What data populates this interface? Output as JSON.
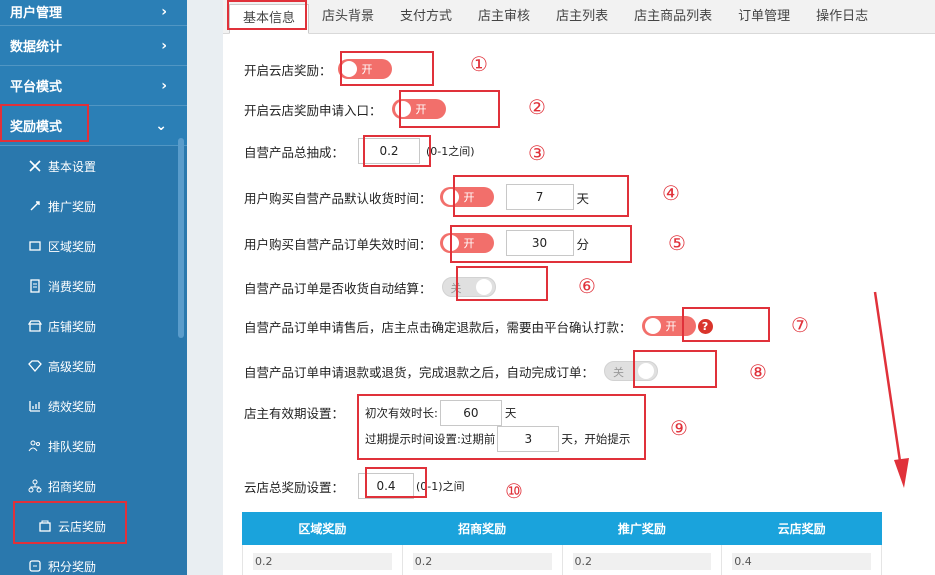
{
  "sidebar": {
    "top": "用户管理",
    "groups": [
      "数据统计",
      "平台模式",
      "奖励模式"
    ],
    "items": [
      "基本设置",
      "推广奖励",
      "区域奖励",
      "消费奖励",
      "店铺奖励",
      "高级奖励",
      "绩效奖励",
      "排队奖励",
      "招商奖励",
      "云店奖励",
      "积分奖励"
    ]
  },
  "tabs": [
    "基本信息",
    "店头背景",
    "支付方式",
    "店主审核",
    "店主列表",
    "店主商品列表",
    "订单管理",
    "操作日志"
  ],
  "switch_on": "开",
  "switch_off": "关",
  "settings": {
    "r1": "开启云店奖励：",
    "r2": "开启云店奖励申请入口：",
    "r3": "自营产品总抽成：",
    "r3_val": "0.2",
    "r3_hint": "(0-1之间)",
    "r4": "用户购买自营产品默认收货时间：",
    "r4_val": "7",
    "r4_unit": "天",
    "r5": "用户购买自营产品订单失效时间：",
    "r5_val": "30",
    "r5_unit": "分",
    "r6": "自营产品订单是否收货自动结算：",
    "r7": "自营产品订单申请售后，店主点击确定退款后，需要由平台确认打款：",
    "r7_help": "?",
    "r8": "自营产品订单申请退款或退货，完成退款之后，自动完成订单：",
    "r9": "店主有效期设置：",
    "r9a": "初次有效时长:",
    "r9a_val": "60",
    "r9a_unit": "天",
    "r9b": "过期提示时间设置:过期前",
    "r9b_val": "3",
    "r9b_unit": "天，开始提示",
    "r10": "云店总奖励设置：",
    "r10_val": "0.4",
    "r10_hint": "(0-1)之间"
  },
  "markers": [
    "①",
    "②",
    "③",
    "④",
    "⑤",
    "⑥",
    "⑦",
    "⑧",
    "⑨",
    "⑩"
  ],
  "table": {
    "headers": [
      "区域奖励",
      "招商奖励",
      "推广奖励",
      "云店奖励"
    ],
    "values": [
      "0.2",
      "0.2",
      "0.2",
      "0.4"
    ]
  },
  "colors": {
    "sidebar": "#2b7fb6",
    "accent": "#e0313a",
    "switch_on": "#f26f6b",
    "table_header": "#1aa3dc"
  }
}
